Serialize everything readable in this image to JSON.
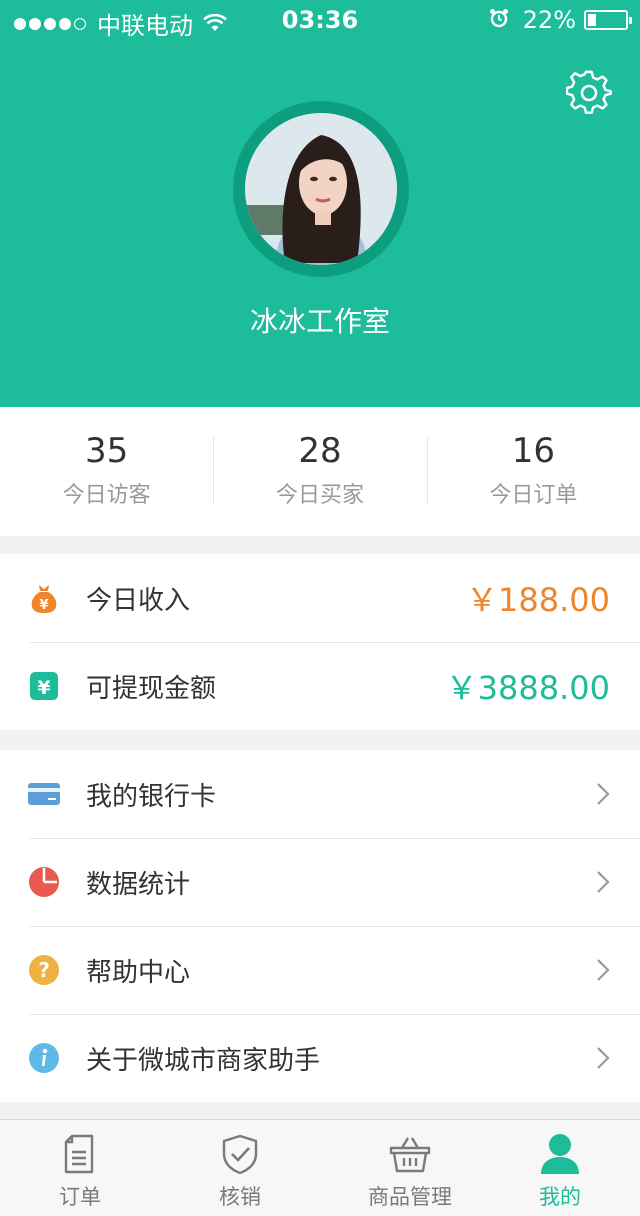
{
  "status_bar": {
    "carrier": "中联电动",
    "time": "03:36",
    "battery_percent": "22%",
    "battery_level": 0.22,
    "signal_dots_filled": 4,
    "signal_dots_total": 5
  },
  "profile": {
    "shop_name": "冰冰工作室",
    "settings_icon": "gear-icon"
  },
  "stats": [
    {
      "value": "35",
      "label": "今日访客"
    },
    {
      "value": "28",
      "label": "今日买家"
    },
    {
      "value": "16",
      "label": "今日订单"
    }
  ],
  "income": {
    "today": {
      "label": "今日收入",
      "amount": "￥188.00",
      "icon": "money-bag-icon"
    },
    "withdrawable": {
      "label": "可提现金额",
      "amount": "￥3888.00",
      "icon": "yuan-icon"
    }
  },
  "menu": [
    {
      "label": "我的银行卡",
      "icon": "bank-card-icon"
    },
    {
      "label": "数据统计",
      "icon": "pie-chart-icon"
    },
    {
      "label": "帮助中心",
      "icon": "help-icon"
    },
    {
      "label": "关于微城市商家助手",
      "icon": "info-icon"
    }
  ],
  "tabs": [
    {
      "label": "订单",
      "icon": "document-icon",
      "active": false
    },
    {
      "label": "核销",
      "icon": "shield-check-icon",
      "active": false
    },
    {
      "label": "商品管理",
      "icon": "basket-icon",
      "active": false
    },
    {
      "label": "我的",
      "icon": "user-icon",
      "active": true
    }
  ],
  "colors": {
    "primary": "#1dbc9b",
    "income_orange": "#f0862b",
    "bank_card_blue": "#5b9fd6",
    "chart_red": "#e85a4f",
    "help_yellow": "#f0b042",
    "info_blue": "#5fb9e6"
  }
}
